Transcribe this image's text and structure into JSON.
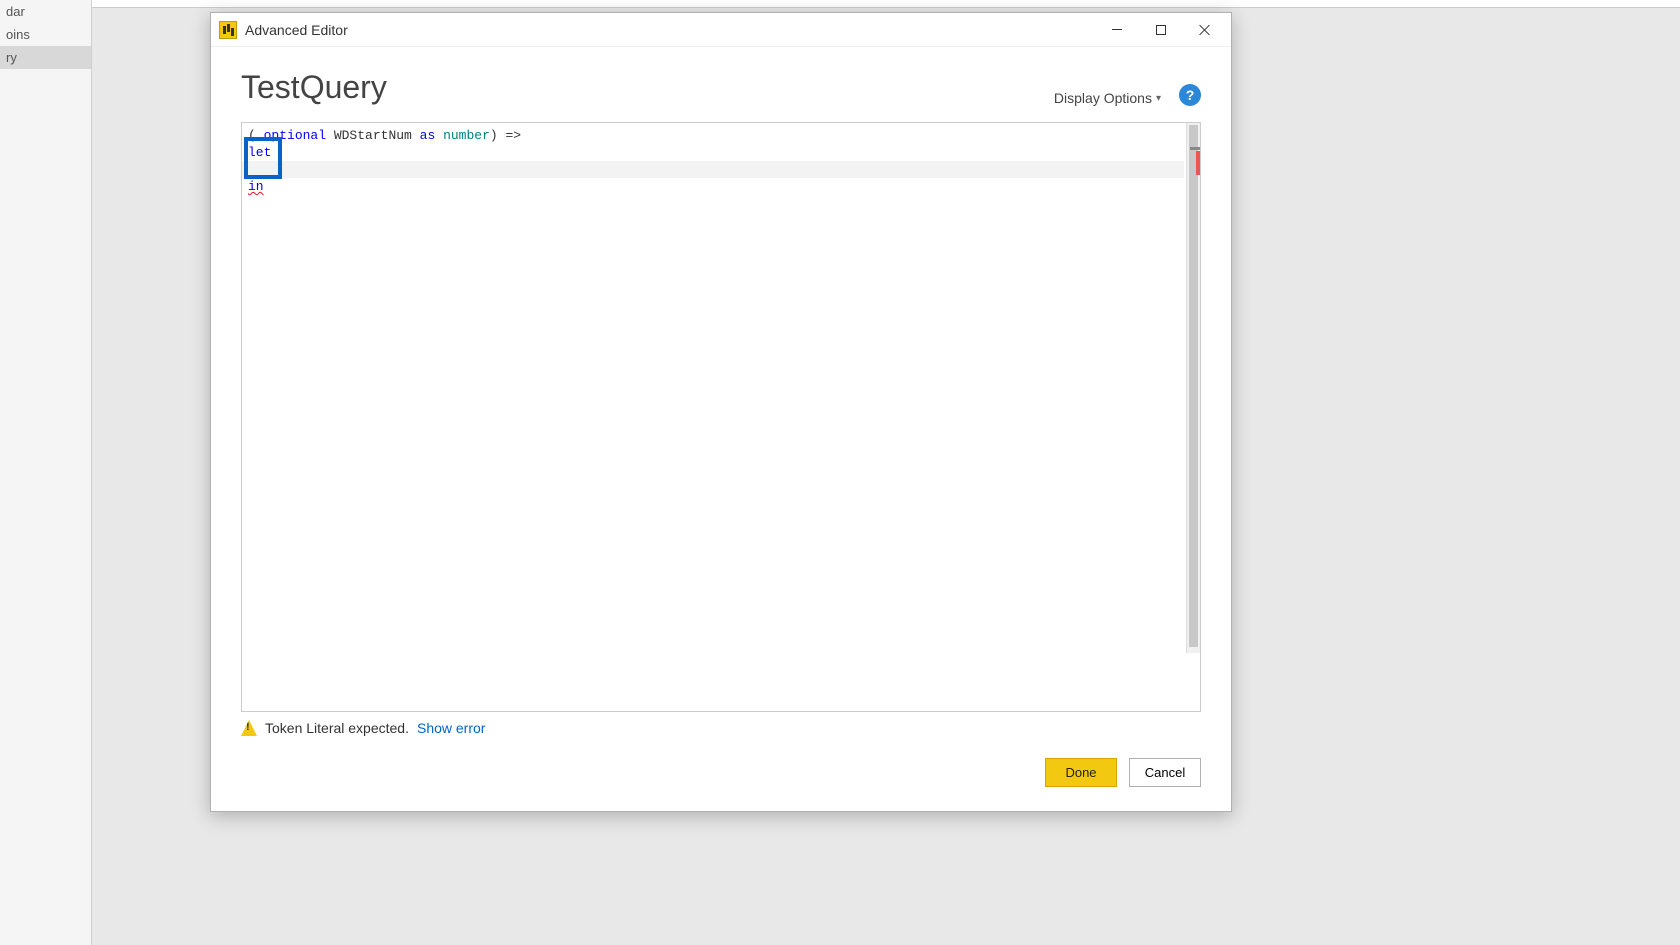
{
  "sidebar": {
    "items": [
      {
        "label": "dar"
      },
      {
        "label": "oins"
      },
      {
        "label": "ry"
      }
    ]
  },
  "titlebar": {
    "title": "Advanced Editor"
  },
  "header": {
    "query_name": "TestQuery",
    "display_options_label": "Display Options",
    "help_tooltip": "Help"
  },
  "code": {
    "line1_part1": "( ",
    "line1_kw_optional": "optional",
    "line1_part2": " WDStartNum ",
    "line1_kw_as": "as",
    "line1_part3": " ",
    "line1_kw_number": "number",
    "line1_part4": ") =>",
    "line2_kw_let": "let",
    "line3": "",
    "line4_kw_in": "in"
  },
  "error": {
    "message": "Token Literal expected.",
    "show_error_label": "Show error"
  },
  "buttons": {
    "done": "Done",
    "cancel": "Cancel"
  }
}
